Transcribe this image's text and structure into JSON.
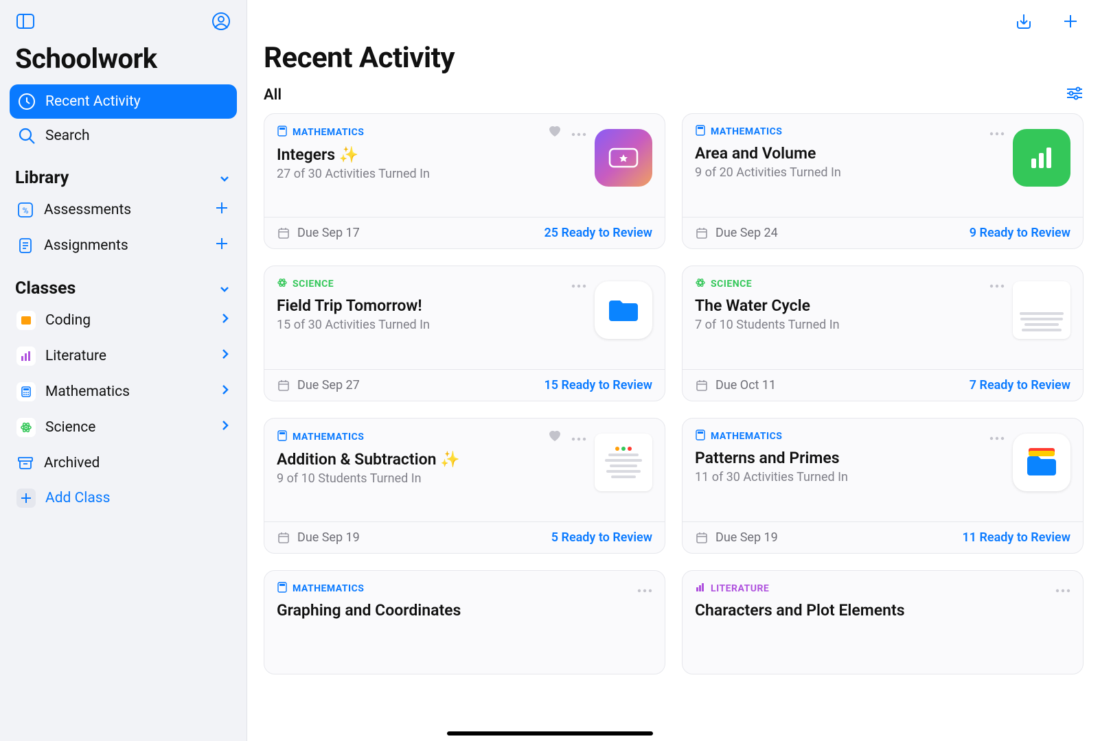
{
  "app_title": "Schoolwork",
  "sidebar": {
    "nav": [
      {
        "label": "Recent Activity",
        "active": true
      },
      {
        "label": "Search",
        "active": false
      }
    ],
    "library_header": "Library",
    "library_items": [
      {
        "label": "Assessments"
      },
      {
        "label": "Assignments"
      }
    ],
    "classes_header": "Classes",
    "classes": [
      {
        "label": "Coding",
        "color": "#ff9f0a",
        "icon": "code"
      },
      {
        "label": "Literature",
        "color": "#af52de",
        "icon": "bars"
      },
      {
        "label": "Mathematics",
        "color": "#0a7aff",
        "icon": "calc"
      },
      {
        "label": "Science",
        "color": "#34c759",
        "icon": "atom"
      }
    ],
    "archived_label": "Archived",
    "add_class_label": "Add Class"
  },
  "main": {
    "title": "Recent Activity",
    "filter_label": "All"
  },
  "cards": [
    {
      "subject": "MATHEMATICS",
      "subject_key": "mathematics",
      "title": "Integers ✨",
      "subtitle": "27 of 30 Activities Turned In",
      "due": "Due Sep 17",
      "review": "25 Ready to Review",
      "fav": true,
      "thumb": "ticket"
    },
    {
      "subject": "MATHEMATICS",
      "subject_key": "mathematics",
      "title": "Area and Volume",
      "subtitle": "9 of 20 Activities Turned In",
      "due": "Due Sep 24",
      "review": "9 Ready to Review",
      "fav": false,
      "thumb": "chart"
    },
    {
      "subject": "SCIENCE",
      "subject_key": "science",
      "title": "Field Trip Tomorrow!",
      "subtitle": "15 of 30 Activities Turned In",
      "due": "Due Sep 27",
      "review": "15 Ready to Review",
      "fav": false,
      "thumb": "folder"
    },
    {
      "subject": "SCIENCE",
      "subject_key": "science",
      "title": "The Water Cycle",
      "subtitle": "7 of 10 Students Turned In",
      "due": "Due Oct 11",
      "review": "7 Ready to Review",
      "fav": false,
      "thumb": "doc"
    },
    {
      "subject": "MATHEMATICS",
      "subject_key": "mathematics",
      "title": "Addition & Subtraction ✨",
      "subtitle": "9 of 10 Students Turned In",
      "due": "Due Sep 19",
      "review": "5 Ready to Review",
      "fav": true,
      "thumb": "worksheet"
    },
    {
      "subject": "MATHEMATICS",
      "subject_key": "mathematics",
      "title": "Patterns and Primes",
      "subtitle": "11 of 30 Activities Turned In",
      "due": "Due Sep 19",
      "review": "11 Ready to Review",
      "fav": false,
      "thumb": "folder2"
    },
    {
      "subject": "MATHEMATICS",
      "subject_key": "mathematics",
      "title": "Graphing and Coordinates",
      "subtitle": "",
      "due": "",
      "review": "",
      "fav": false,
      "thumb": "none"
    },
    {
      "subject": "LITERATURE",
      "subject_key": "literature",
      "title": "Characters and Plot Elements",
      "subtitle": "",
      "due": "",
      "review": "",
      "fav": false,
      "thumb": "none"
    }
  ]
}
